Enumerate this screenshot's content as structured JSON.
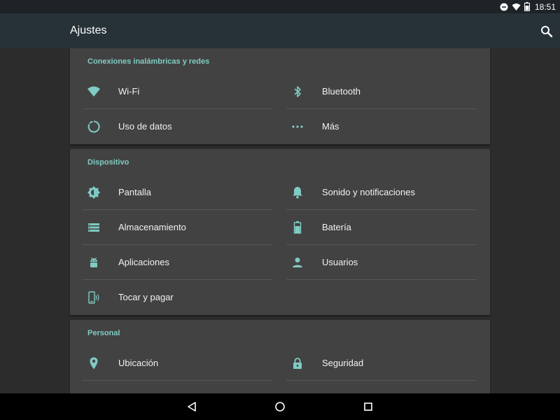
{
  "status_bar": {
    "time": "18:51",
    "icons": [
      "do-not-disturb-icon",
      "wifi-signal-icon",
      "battery-icon"
    ]
  },
  "app_bar": {
    "title": "Ajustes",
    "search_icon": "search-icon"
  },
  "accent_color": "#80cbc4",
  "sections": [
    {
      "header": "Conexiones inalámbricas y redes",
      "items": [
        {
          "label": "Wi-Fi",
          "icon": "wifi-icon"
        },
        {
          "label": "Bluetooth",
          "icon": "bluetooth-icon"
        },
        {
          "label": "Uso de datos",
          "icon": "data-usage-icon"
        },
        {
          "label": "Más",
          "icon": "more-dots-icon"
        }
      ]
    },
    {
      "header": "Dispositivo",
      "items": [
        {
          "label": "Pantalla",
          "icon": "brightness-icon"
        },
        {
          "label": "Sonido y notificaciones",
          "icon": "bell-icon"
        },
        {
          "label": "Almacenamiento",
          "icon": "storage-icon"
        },
        {
          "label": "Batería",
          "icon": "battery-icon"
        },
        {
          "label": "Aplicaciones",
          "icon": "android-icon"
        },
        {
          "label": "Usuarios",
          "icon": "person-icon"
        },
        {
          "label": "Tocar y pagar",
          "icon": "tap-and-pay-icon"
        }
      ]
    },
    {
      "header": "Personal",
      "items": [
        {
          "label": "Ubicación",
          "icon": "location-icon"
        },
        {
          "label": "Seguridad",
          "icon": "lock-icon"
        }
      ]
    }
  ],
  "nav_bar": {
    "buttons": [
      "back-icon",
      "home-icon",
      "recents-icon"
    ]
  }
}
